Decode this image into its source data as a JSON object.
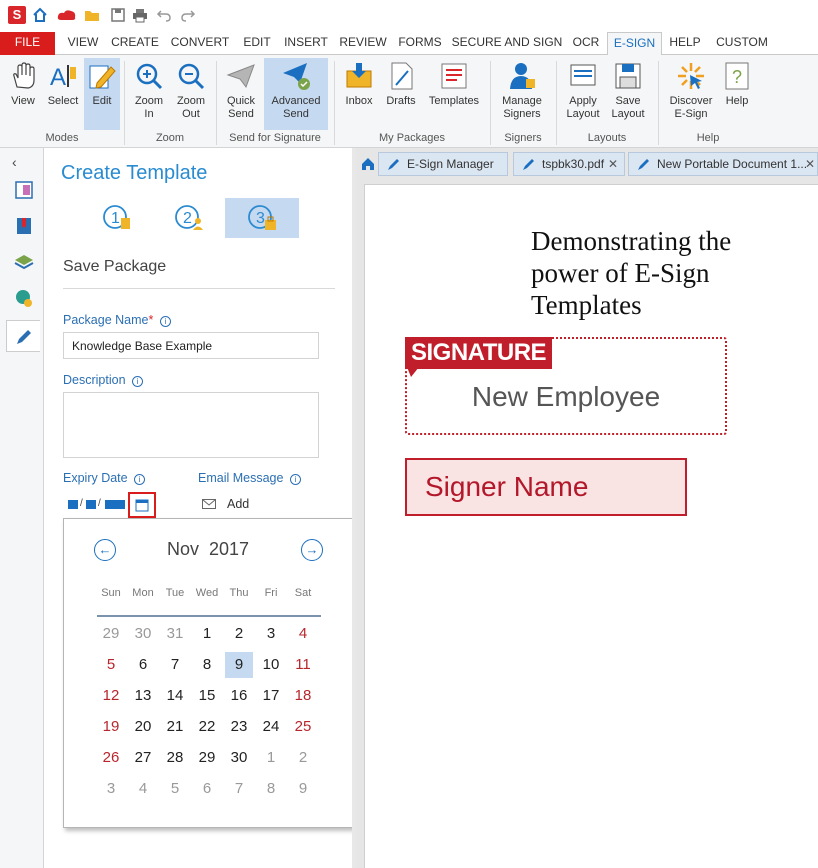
{
  "quick_access": {
    "logo": "S",
    "icons": [
      "home-icon",
      "cloud-icon",
      "open-folder-icon",
      "save-icon",
      "print-icon",
      "undo-icon",
      "redo-icon"
    ]
  },
  "menu_tabs": [
    "FILE",
    "VIEW",
    "CREATE",
    "CONVERT",
    "EDIT",
    "INSERT",
    "REVIEW",
    "FORMS",
    "SECURE AND SIGN",
    "OCR",
    "E-SIGN",
    "HELP",
    "CUSTOM"
  ],
  "active_tab": "E-SIGN",
  "ribbon": {
    "buttons": {
      "view": "View",
      "select": "Select",
      "edit": "Edit",
      "zoom_in": "Zoom In",
      "zoom_out": "Zoom Out",
      "quick_send": "Quick Send",
      "advanced_send": "Advanced Send",
      "inbox": "Inbox",
      "drafts": "Drafts",
      "templates": "Templates",
      "manage_signers": "Manage Signers",
      "apply_layout": "Apply Layout",
      "save_layout": "Save Layout",
      "discover": "Discover E-Sign",
      "help": "Help"
    },
    "groups": {
      "modes": "Modes",
      "zoom": "Zoom",
      "send": "Send for Signature",
      "packages": "My Packages",
      "signers": "Signers",
      "layouts": "Layouts",
      "help": "Help"
    }
  },
  "panel": {
    "title": "Create Template",
    "steps": [
      "1",
      "2",
      "3"
    ],
    "active_step": 3,
    "subtitle": "Save Package",
    "package_name_label": "Package Name",
    "package_name_value": "Knowledge Base Example",
    "description_label": "Description",
    "description_value": "",
    "expiry_label": "Expiry Date",
    "email_label": "Email Message",
    "email_add": "Add"
  },
  "calendar": {
    "month": "Nov",
    "year": "2017",
    "weekdays": [
      "Sun",
      "Mon",
      "Tue",
      "Wed",
      "Thu",
      "Fri",
      "Sat"
    ],
    "weeks": [
      [
        "29",
        "30",
        "31",
        "1",
        "2",
        "3",
        "4"
      ],
      [
        "5",
        "6",
        "7",
        "8",
        "9",
        "10",
        "11"
      ],
      [
        "12",
        "13",
        "14",
        "15",
        "16",
        "17",
        "18"
      ],
      [
        "19",
        "20",
        "21",
        "22",
        "23",
        "24",
        "25"
      ],
      [
        "26",
        "27",
        "28",
        "29",
        "30",
        "1",
        "2"
      ],
      [
        "3",
        "4",
        "5",
        "6",
        "7",
        "8",
        "9"
      ]
    ],
    "selected_day": "9"
  },
  "doc_tabs": [
    "E-Sign Manager",
    "tspbk30.pdf",
    "New Portable Document 1..."
  ],
  "document": {
    "heading_lines": [
      "Demonstrating the",
      "power of E-Sign",
      "Templates"
    ],
    "signature_flag": "SIGNATURE",
    "signature_role": "New Employee",
    "signer_name": "Signer Name"
  },
  "colors": {
    "brand_red": "#d91d1d",
    "accent_blue": "#1a6fc0",
    "selection": "#c5d9f0",
    "sig_red": "#c01e2a"
  }
}
